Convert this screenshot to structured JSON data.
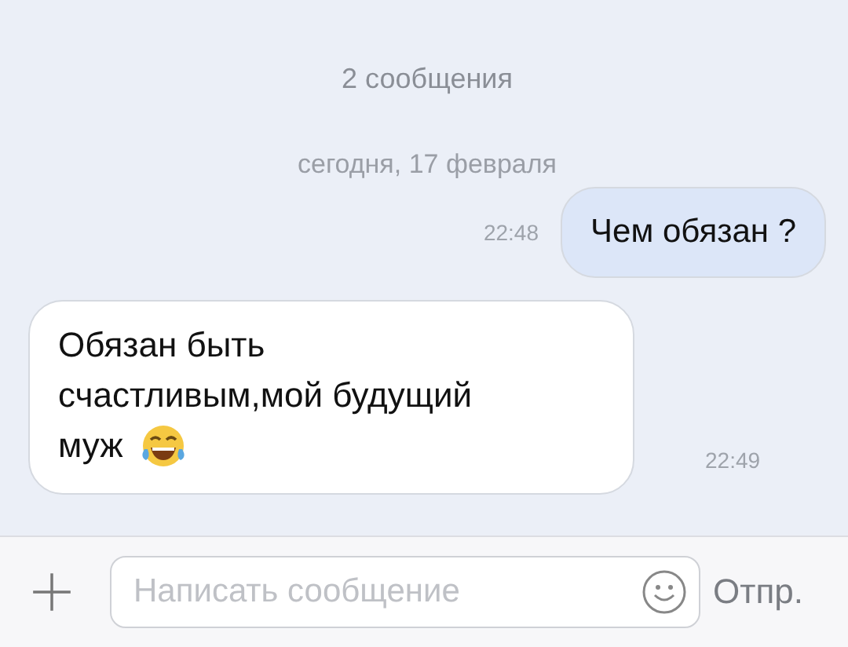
{
  "header": {
    "count": "2 сообщения",
    "date": "сегодня, 17 февраля"
  },
  "messages": [
    {
      "kind": "outgoing",
      "lines": [
        "Чем обязан ?"
      ],
      "time": "22:48",
      "emoji": false
    },
    {
      "kind": "incoming",
      "lines": [
        "Обязан быть",
        "счастливым,мой будущий",
        "муж"
      ],
      "time": "22:49",
      "emoji": true
    }
  ],
  "composer": {
    "placeholder": "Написать сообщение",
    "send": "Отпр."
  }
}
